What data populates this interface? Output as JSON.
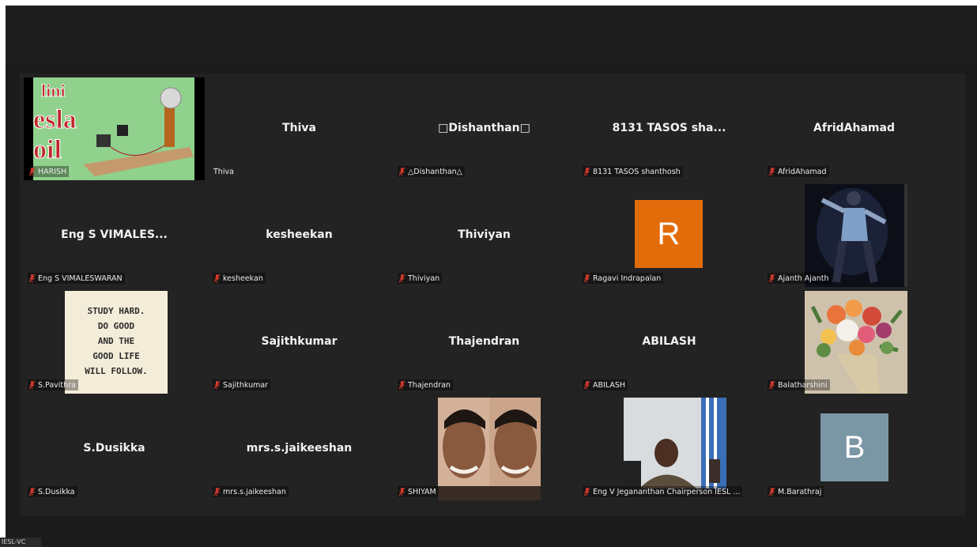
{
  "meeting": {
    "footer_label": "IESL-VC",
    "mic_muted_color": "#d33a2c",
    "tiles": [
      {
        "display_name": "",
        "label": "HARISH",
        "has_media": true,
        "media_kind": "tesla-coil-thumbnail",
        "media_text": "Mini Tesla Coil"
      },
      {
        "display_name": "Thiva",
        "label": "Thiva",
        "muted": false
      },
      {
        "display_name": "□Dishanthan□",
        "label": "△Dishanthan△",
        "muted": true
      },
      {
        "display_name": "8131 TASOS  sha...",
        "label": "8131 TASOS  shanthosh",
        "muted": true
      },
      {
        "display_name": "AfridAhamad",
        "label": "AfridAhamad",
        "muted": true
      },
      {
        "display_name": "Eng S VIMALES...",
        "label": "Eng S VIMALESWARAN",
        "muted": true
      },
      {
        "display_name": "kesheekan",
        "label": "kesheekan",
        "muted": true
      },
      {
        "display_name": "Thiviyan",
        "label": "Thiviyan",
        "muted": true
      },
      {
        "display_name": "",
        "label": "Ragavi Indrapalan",
        "muted": true,
        "avatar_letter": "R",
        "avatar_color": "#e36c0a"
      },
      {
        "display_name": "",
        "label": "Ajanth Ajanth",
        "muted": true,
        "has_media": true,
        "media_kind": "dancer-photo"
      },
      {
        "display_name": "",
        "label": "S.Pavithra",
        "muted": true,
        "has_media": true,
        "media_kind": "quote-poster",
        "poster_lines": [
          "STUDY HARD.",
          "DO GOOD",
          "AND THE",
          "GOOD LIFE",
          "WILL FOLLOW."
        ]
      },
      {
        "display_name": "Sajithkumar",
        "label": "Sajithkumar",
        "muted": true
      },
      {
        "display_name": "Thajendran",
        "label": "Thajendran",
        "muted": true
      },
      {
        "display_name": "ABILASH",
        "label": "ABILASH",
        "muted": true
      },
      {
        "display_name": "",
        "label": "Balatharshini",
        "muted": true,
        "has_media": true,
        "media_kind": "flower-bouquet"
      },
      {
        "display_name": "S.Dusikka",
        "label": "S.Dusikka",
        "muted": true
      },
      {
        "display_name": "mrs.s.jaikeeshan",
        "label": "mrs.s.jaikeeshan",
        "muted": true
      },
      {
        "display_name": "",
        "label": "SHIYAM",
        "muted": true,
        "has_media": true,
        "media_kind": "portrait-photo"
      },
      {
        "display_name": "",
        "label": "Eng V Jegananthan Chairperson IESL ...",
        "muted": true,
        "has_media": true,
        "media_kind": "webcam-video"
      },
      {
        "display_name": "",
        "label": "M.Barathraj",
        "muted": true,
        "avatar_letter": "B",
        "avatar_color": "#7b97a6"
      }
    ]
  }
}
